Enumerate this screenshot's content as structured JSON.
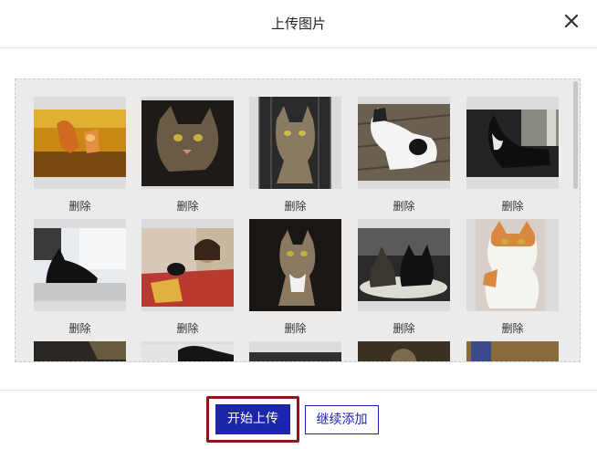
{
  "dialog": {
    "title": "上传图片",
    "close_icon": "close-icon"
  },
  "gallery": {
    "items": [
      {
        "name": "cat-orange-kitten",
        "delete_label": "删除"
      },
      {
        "name": "cat-tabby-closeup",
        "delete_label": "删除"
      },
      {
        "name": "cat-tabby-cage",
        "delete_label": "删除"
      },
      {
        "name": "cat-white-black-kitten",
        "delete_label": "删除"
      },
      {
        "name": "cat-black-white-room",
        "delete_label": "删除"
      },
      {
        "name": "cat-black-window",
        "delete_label": "删除"
      },
      {
        "name": "cat-girl-bed",
        "delete_label": "删除"
      },
      {
        "name": "cat-tabby-dark",
        "delete_label": "删除"
      },
      {
        "name": "cat-two-bed",
        "delete_label": "删除"
      },
      {
        "name": "cat-calico-sitting",
        "delete_label": "删除"
      }
    ]
  },
  "footer": {
    "start_upload_label": "开始上传",
    "continue_add_label": "继续添加"
  },
  "colors": {
    "primary": "#1d26a8",
    "highlight_border": "#8b1a1a"
  }
}
